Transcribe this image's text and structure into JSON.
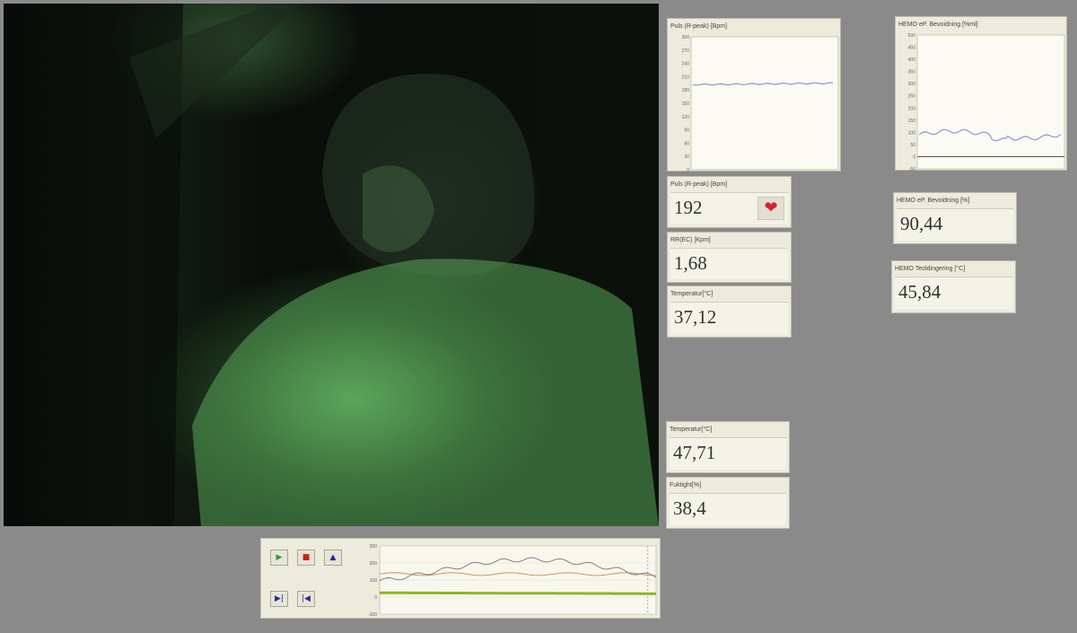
{
  "panels": {
    "pulse_chart": {
      "caption": "Puls (R-peak) [Bpm]",
      "yticks": [
        "300",
        "270",
        "240",
        "210",
        "180",
        "150",
        "120",
        "90",
        "60",
        "30",
        "0"
      ]
    },
    "blood_chart": {
      "caption": "HEMO eP. Bevoidning [%ml]",
      "yticks": [
        "500",
        "450",
        "400",
        "350",
        "300",
        "250",
        "200",
        "150",
        "100",
        "50",
        "0",
        "-50"
      ]
    },
    "pulse": {
      "caption": "Puls (R-peak) [Bpm]",
      "value": "192",
      "icon": "heart-icon"
    },
    "rr": {
      "caption": "RR(EC) [Kpm]",
      "value": "1,68"
    },
    "temp1": {
      "caption": "Temperatur[°C]",
      "value": "37,12"
    },
    "blood_pct": {
      "caption": "HEMO eP. Bevoidning [%]",
      "value": "90,44"
    },
    "blood_temp": {
      "caption": "HEMO Teoldingering [°C]",
      "value": "45,84"
    },
    "temp2": {
      "caption": "Temperatur[°C]",
      "value": "47,71"
    },
    "humidity": {
      "caption": "Fuktight[%]",
      "value": "38,4"
    }
  },
  "playback": {
    "buttons": [
      {
        "name": "play-button",
        "icon": "play-icon",
        "glyph": "▶",
        "color": "#2e9b2e"
      },
      {
        "name": "stop-button",
        "icon": "stop-icon",
        "glyph": "■",
        "color": "#cc2020"
      },
      {
        "name": "eject-button",
        "icon": "eject-icon",
        "glyph": "▲",
        "color": "#2a2a9a"
      },
      {
        "name": "step-forward-button",
        "icon": "step-forward-icon",
        "glyph": "▶|",
        "color": "#2a2a9a"
      },
      {
        "name": "step-back-button",
        "icon": "step-back-icon",
        "glyph": "|◀",
        "color": "#2a2a9a"
      }
    ],
    "yticks": [
      "300",
      "200",
      "100",
      "0",
      "-100"
    ]
  },
  "colors": {
    "trace": "#8f92d6",
    "heart": "#d8232a",
    "timeline_green": "#8cb81e",
    "timeline_orange": "#c98a47"
  }
}
